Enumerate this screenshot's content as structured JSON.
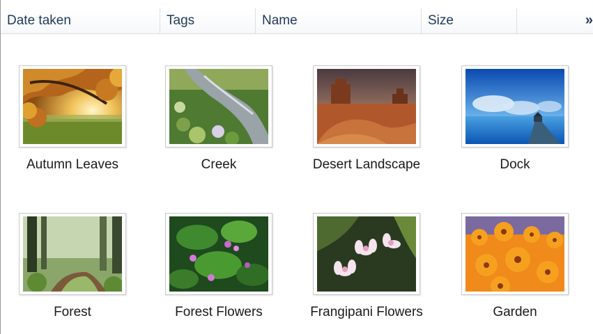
{
  "columns": {
    "date_taken": "Date taken",
    "tags": "Tags",
    "name": "Name",
    "size": "Size",
    "more": "»"
  },
  "items": [
    {
      "name": "Autumn Leaves",
      "icon": "autumn-leaves-thumbnail"
    },
    {
      "name": "Creek",
      "icon": "creek-thumbnail"
    },
    {
      "name": "Desert Landscape",
      "icon": "desert-landscape-thumbnail"
    },
    {
      "name": "Dock",
      "icon": "dock-thumbnail"
    },
    {
      "name": "Forest",
      "icon": "forest-thumbnail"
    },
    {
      "name": "Forest Flowers",
      "icon": "forest-flowers-thumbnail"
    },
    {
      "name": "Frangipani Flowers",
      "icon": "frangipani-flowers-thumbnail"
    },
    {
      "name": "Garden",
      "icon": "garden-thumbnail"
    }
  ]
}
